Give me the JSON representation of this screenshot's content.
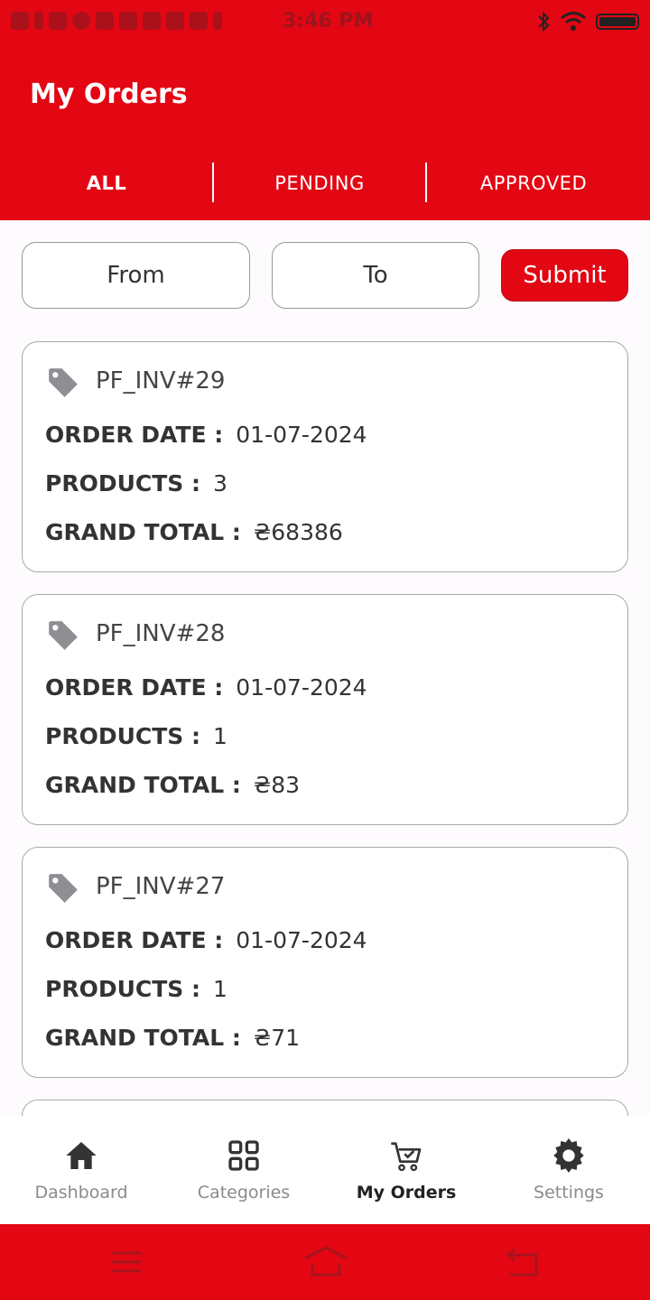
{
  "status_bar": {
    "time": "3:46 PM"
  },
  "header": {
    "title": "My Orders"
  },
  "tabs": [
    {
      "label": "ALL",
      "active": true
    },
    {
      "label": "PENDING",
      "active": false
    },
    {
      "label": "APPROVED",
      "active": false
    }
  ],
  "filter": {
    "from_label": "From",
    "to_label": "To",
    "submit_label": "Submit"
  },
  "labels": {
    "order_date": "ORDER DATE :",
    "products": "PRODUCTS :",
    "grand_total": "GRAND TOTAL :"
  },
  "orders": [
    {
      "invoice": "PF_INV#29",
      "order_date": "01-07-2024",
      "products": "3",
      "grand_total": "₴68386"
    },
    {
      "invoice": "PF_INV#28",
      "order_date": "01-07-2024",
      "products": "1",
      "grand_total": "₴83"
    },
    {
      "invoice": "PF_INV#27",
      "order_date": "01-07-2024",
      "products": "1",
      "grand_total": "₴71"
    }
  ],
  "bottom_nav": [
    {
      "label": "Dashboard",
      "icon": "home-icon",
      "active": false
    },
    {
      "label": "Categories",
      "icon": "grid-icon",
      "active": false
    },
    {
      "label": "My Orders",
      "icon": "cart-icon",
      "active": true
    },
    {
      "label": "Settings",
      "icon": "gear-icon",
      "active": false
    }
  ],
  "colors": {
    "primary": "#e30613",
    "background": "#fdfbfd",
    "tag_icon": "#8e8e93"
  }
}
